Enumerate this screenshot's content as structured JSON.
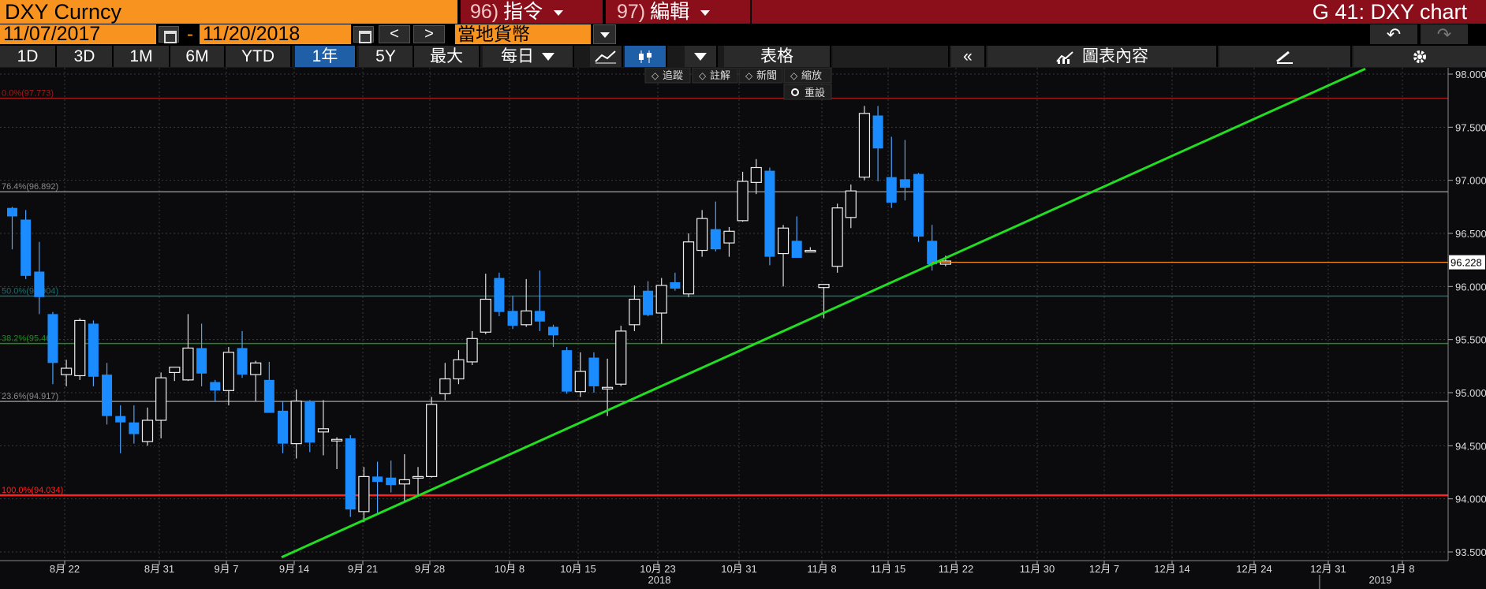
{
  "header": {
    "ticker": "DXY Curncy",
    "cmd1_num": "96)",
    "cmd1_label": "指令",
    "cmd2_num": "97)",
    "cmd2_label": "編輯",
    "title": "G 41: DXY chart"
  },
  "dates": {
    "start": "11/07/2017",
    "separator": "-",
    "end": "11/20/2018",
    "prev": "<",
    "next": ">",
    "currency": "當地貨幣"
  },
  "toolbar": {
    "periods": [
      "1D",
      "3D",
      "1M",
      "6M",
      "YTD",
      "1年",
      "5Y",
      "最大"
    ],
    "active_period": "1年",
    "frequency": "每日",
    "table_label": "表格",
    "collapse": "«",
    "chart_content": "圖表內容"
  },
  "drawing_tools": [
    "追蹤",
    "註解",
    "新聞",
    "縮放"
  ],
  "reset_label": "重設",
  "colors": {
    "bull": "#ffffff",
    "bear": "#1a8cff",
    "trendline": "#22dd22",
    "last_price_line": "#f7931e",
    "background": "#0b0b0d",
    "fib_100": "#ff2020",
    "fib_0": "#a01a1a",
    "accent_orange": "#f7931e",
    "title_red": "#8b0e1b"
  },
  "chart_data": {
    "type": "candlestick",
    "ylim": [
      93.45,
      98.1
    ],
    "y_ticks": [
      "93.500",
      "94.000",
      "94.500",
      "95.000",
      "95.500",
      "96.000",
      "96.500",
      "97.000",
      "97.500",
      "98.000"
    ],
    "last_price": "96.228",
    "x_tick_labels": [
      "8月 22",
      "8月 31",
      "9月 7",
      "9月 14",
      "9月 21",
      "9月 28",
      "10月 8",
      "10月 15",
      "10月 23",
      "10月 31",
      "11月 8",
      "11月 15",
      "11月 22",
      "11月 30",
      "12月 7",
      "12月 14",
      "12月 24",
      "12月 31",
      "1月 8"
    ],
    "year_labels": [
      "2018",
      "2019"
    ],
    "fib_levels": [
      {
        "label": "0.0%(97.773)",
        "value": 97.773,
        "color": "#a01a1a"
      },
      {
        "label": "76.4%(96.892)",
        "value": 96.892,
        "color": "#8a8a8a"
      },
      {
        "label": "50.0%(95.904)",
        "value": 95.91,
        "color": "#1d6b6b"
      },
      {
        "label": "38.2%(95.463)",
        "value": 95.463,
        "color": "#1e8a1e"
      },
      {
        "label": "23.6%(94.917)",
        "value": 94.917,
        "color": "#8a8a8a"
      },
      {
        "label": "100.0%(94.034)",
        "value": 94.034,
        "color": "#ff2020"
      }
    ],
    "trendline": {
      "start": {
        "date": "9月 13",
        "value": 93.45
      },
      "end": {
        "date": "2019 1月 4",
        "value": 98.05
      }
    },
    "candles": [
      {
        "o": 96.74,
        "h": 96.75,
        "l": 96.35,
        "c": 96.66
      },
      {
        "o": 96.63,
        "h": 96.72,
        "l": 96.07,
        "c": 96.1
      },
      {
        "o": 96.14,
        "h": 96.42,
        "l": 95.74,
        "c": 95.9
      },
      {
        "o": 95.74,
        "h": 95.76,
        "l": 95.08,
        "c": 95.28
      },
      {
        "o": 95.17,
        "h": 95.31,
        "l": 95.06,
        "c": 95.23
      },
      {
        "o": 95.16,
        "h": 95.7,
        "l": 95.12,
        "c": 95.68
      },
      {
        "o": 95.65,
        "h": 95.68,
        "l": 95.06,
        "c": 95.15
      },
      {
        "o": 95.17,
        "h": 95.28,
        "l": 94.7,
        "c": 94.78
      },
      {
        "o": 94.78,
        "h": 94.88,
        "l": 94.43,
        "c": 94.72
      },
      {
        "o": 94.72,
        "h": 94.88,
        "l": 94.52,
        "c": 94.61
      },
      {
        "o": 94.54,
        "h": 94.86,
        "l": 94.5,
        "c": 94.74
      },
      {
        "o": 94.74,
        "h": 95.19,
        "l": 94.57,
        "c": 95.14
      },
      {
        "o": 95.19,
        "h": 95.23,
        "l": 95.11,
        "c": 95.24
      },
      {
        "o": 95.12,
        "h": 95.74,
        "l": 95.11,
        "c": 95.42
      },
      {
        "o": 95.42,
        "h": 95.65,
        "l": 95.06,
        "c": 95.18
      },
      {
        "o": 95.1,
        "h": 95.12,
        "l": 94.92,
        "c": 95.02
      },
      {
        "o": 95.02,
        "h": 95.43,
        "l": 94.88,
        "c": 95.38
      },
      {
        "o": 95.42,
        "h": 95.58,
        "l": 95.14,
        "c": 95.17
      },
      {
        "o": 95.17,
        "h": 95.3,
        "l": 94.92,
        "c": 95.28
      },
      {
        "o": 95.12,
        "h": 95.29,
        "l": 94.81,
        "c": 94.81
      },
      {
        "o": 94.83,
        "h": 94.92,
        "l": 94.43,
        "c": 94.52
      },
      {
        "o": 94.52,
        "h": 95.03,
        "l": 94.38,
        "c": 94.92
      },
      {
        "o": 94.92,
        "h": 94.93,
        "l": 94.44,
        "c": 94.53
      },
      {
        "o": 94.63,
        "h": 94.93,
        "l": 94.41,
        "c": 94.66
      },
      {
        "o": 94.56,
        "h": 94.58,
        "l": 94.28,
        "c": 94.56
      },
      {
        "o": 94.57,
        "h": 94.6,
        "l": 93.83,
        "c": 93.9
      },
      {
        "o": 93.88,
        "h": 94.3,
        "l": 93.78,
        "c": 94.21
      },
      {
        "o": 94.21,
        "h": 94.35,
        "l": 93.86,
        "c": 94.16
      },
      {
        "o": 94.2,
        "h": 94.36,
        "l": 94.06,
        "c": 94.13
      },
      {
        "o": 94.14,
        "h": 94.42,
        "l": 93.98,
        "c": 94.18
      },
      {
        "o": 94.21,
        "h": 94.3,
        "l": 94.04,
        "c": 94.21
      },
      {
        "o": 94.21,
        "h": 94.96,
        "l": 94.2,
        "c": 94.89
      },
      {
        "o": 94.99,
        "h": 95.28,
        "l": 94.93,
        "c": 95.13
      },
      {
        "o": 95.13,
        "h": 95.4,
        "l": 95.08,
        "c": 95.31
      },
      {
        "o": 95.29,
        "h": 95.58,
        "l": 95.26,
        "c": 95.51
      },
      {
        "o": 95.57,
        "h": 96.12,
        "l": 95.55,
        "c": 95.88
      },
      {
        "o": 96.08,
        "h": 96.13,
        "l": 95.72,
        "c": 95.76
      },
      {
        "o": 95.77,
        "h": 95.91,
        "l": 95.6,
        "c": 95.63
      },
      {
        "o": 95.64,
        "h": 96.07,
        "l": 95.62,
        "c": 95.77
      },
      {
        "o": 95.77,
        "h": 96.15,
        "l": 95.58,
        "c": 95.67
      },
      {
        "o": 95.62,
        "h": 95.64,
        "l": 95.43,
        "c": 95.54
      },
      {
        "o": 95.4,
        "h": 95.43,
        "l": 94.99,
        "c": 95.01
      },
      {
        "o": 95.01,
        "h": 95.38,
        "l": 94.96,
        "c": 95.2
      },
      {
        "o": 95.33,
        "h": 95.38,
        "l": 95.0,
        "c": 95.06
      },
      {
        "o": 95.05,
        "h": 95.32,
        "l": 94.78,
        "c": 95.05
      },
      {
        "o": 95.08,
        "h": 95.63,
        "l": 95.06,
        "c": 95.58
      },
      {
        "o": 95.64,
        "h": 96.01,
        "l": 95.58,
        "c": 95.88
      },
      {
        "o": 95.96,
        "h": 96.05,
        "l": 95.72,
        "c": 95.73
      },
      {
        "o": 95.75,
        "h": 96.08,
        "l": 95.46,
        "c": 96.01
      },
      {
        "o": 96.04,
        "h": 96.13,
        "l": 95.96,
        "c": 95.98
      },
      {
        "o": 95.93,
        "h": 96.5,
        "l": 95.9,
        "c": 96.42
      },
      {
        "o": 96.34,
        "h": 96.72,
        "l": 96.28,
        "c": 96.64
      },
      {
        "o": 96.54,
        "h": 96.8,
        "l": 96.33,
        "c": 96.35
      },
      {
        "o": 96.41,
        "h": 96.56,
        "l": 96.28,
        "c": 96.52
      },
      {
        "o": 96.62,
        "h": 97.08,
        "l": 96.61,
        "c": 96.99
      },
      {
        "o": 96.98,
        "h": 97.2,
        "l": 96.87,
        "c": 97.12
      },
      {
        "o": 97.09,
        "h": 97.12,
        "l": 96.2,
        "c": 96.28
      },
      {
        "o": 96.31,
        "h": 96.58,
        "l": 96.0,
        "c": 96.55
      },
      {
        "o": 96.43,
        "h": 96.66,
        "l": 96.3,
        "c": 96.27
      },
      {
        "o": 96.34,
        "h": 96.37,
        "l": 96.33,
        "c": 96.34
      },
      {
        "o": 95.99,
        "h": 96.02,
        "l": 95.7,
        "c": 96.02
      },
      {
        "o": 96.19,
        "h": 96.78,
        "l": 96.13,
        "c": 96.74
      },
      {
        "o": 96.65,
        "h": 96.96,
        "l": 96.55,
        "c": 96.9
      },
      {
        "o": 97.03,
        "h": 97.7,
        "l": 97.0,
        "c": 97.63
      },
      {
        "o": 97.61,
        "h": 97.7,
        "l": 96.99,
        "c": 97.3
      },
      {
        "o": 97.03,
        "h": 97.41,
        "l": 96.74,
        "c": 96.79
      },
      {
        "o": 97.01,
        "h": 97.38,
        "l": 96.81,
        "c": 96.93
      },
      {
        "o": 97.06,
        "h": 97.07,
        "l": 96.42,
        "c": 96.47
      },
      {
        "o": 96.43,
        "h": 96.58,
        "l": 96.15,
        "c": 96.21
      },
      {
        "o": 96.21,
        "h": 96.29,
        "l": 96.19,
        "c": 96.24
      }
    ]
  }
}
